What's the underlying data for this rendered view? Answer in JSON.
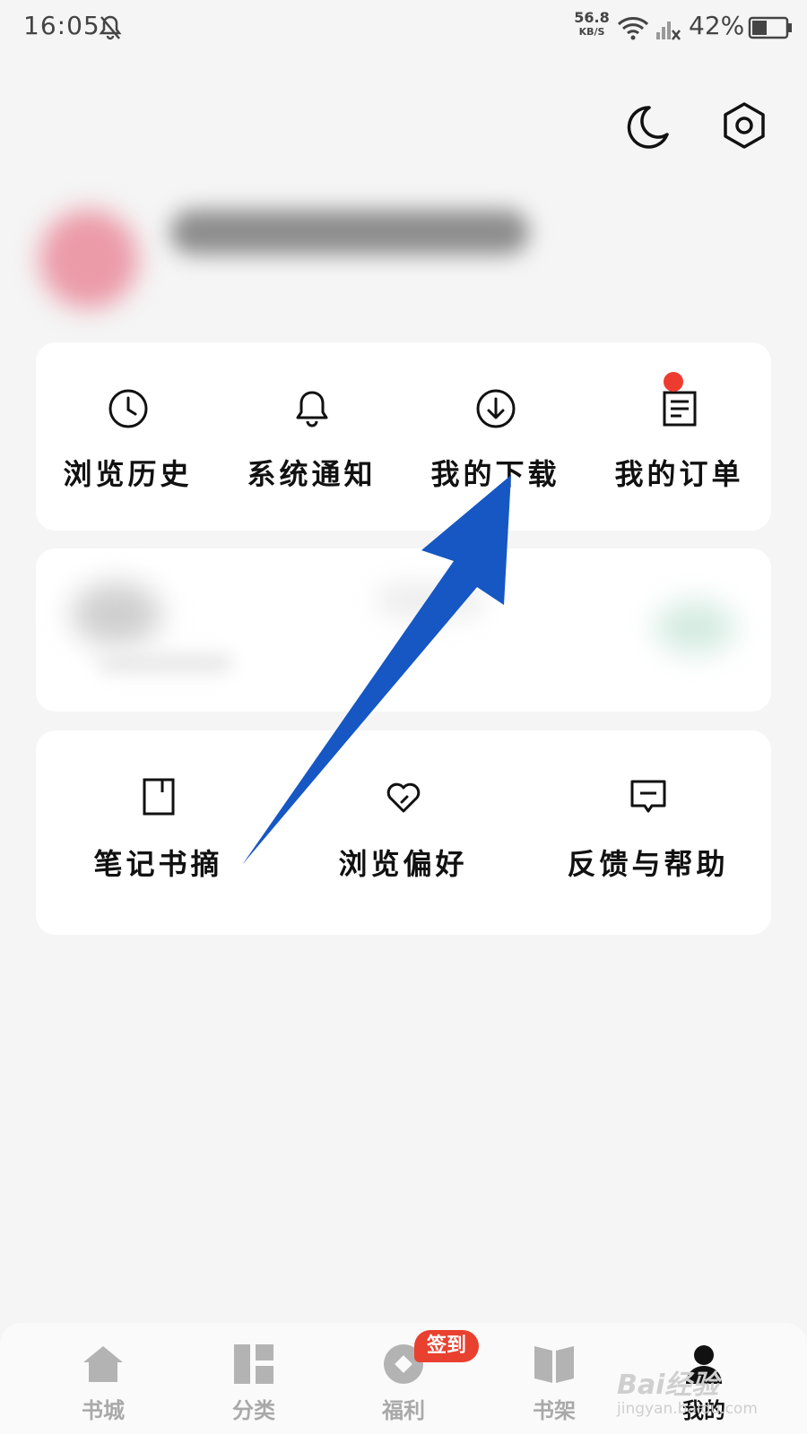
{
  "status_bar": {
    "time": "16:05",
    "net_speed_value": "56.8",
    "net_speed_unit": "KB/S",
    "battery": "42%"
  },
  "grid1": [
    {
      "label": "浏览历史",
      "icon": "clock-icon"
    },
    {
      "label": "系统通知",
      "icon": "bell-icon"
    },
    {
      "label": "我的下载",
      "icon": "download-icon"
    },
    {
      "label": "我的订单",
      "icon": "order-icon",
      "has_dot": true
    }
  ],
  "grid2": [
    {
      "label": "笔记书摘",
      "icon": "bookmark-icon"
    },
    {
      "label": "浏览偏好",
      "icon": "heart-icon"
    },
    {
      "label": "反馈与帮助",
      "icon": "chat-icon"
    }
  ],
  "bottom_nav": [
    {
      "label": "书城",
      "icon": "home-icon"
    },
    {
      "label": "分类",
      "icon": "category-icon"
    },
    {
      "label": "福利",
      "icon": "coin-icon"
    },
    {
      "label": "书架",
      "icon": "book-icon"
    },
    {
      "label": "我的",
      "icon": "user-icon",
      "active": true
    }
  ],
  "badge": "签到",
  "watermark": {
    "brand": "Bai经验",
    "url": "jingyan.baidu.com"
  },
  "colors": {
    "arrow": "#1657c4",
    "red": "#ee3b30",
    "badge": "#e8412f"
  }
}
